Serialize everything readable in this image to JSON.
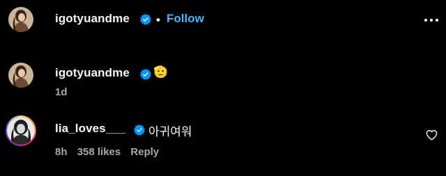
{
  "post_header": {
    "username": "igotyuandme",
    "separator": "•",
    "follow_label": "Follow"
  },
  "caption": {
    "username": "igotyuandme",
    "emoji": "🫡",
    "time": "1d"
  },
  "comment": {
    "username": "lia_loves___",
    "text": "아귀여워",
    "time": "8h",
    "likes": "358 likes",
    "reply_label": "Reply"
  },
  "colors": {
    "background": "#000000",
    "text": "#f5f5f5",
    "muted": "#a8a8a8",
    "follow": "#4cb5f9",
    "verified": "#0095f6"
  },
  "icons": {
    "more": "more-options-icon",
    "verified": "verified-badge-icon",
    "like": "heart-icon"
  }
}
